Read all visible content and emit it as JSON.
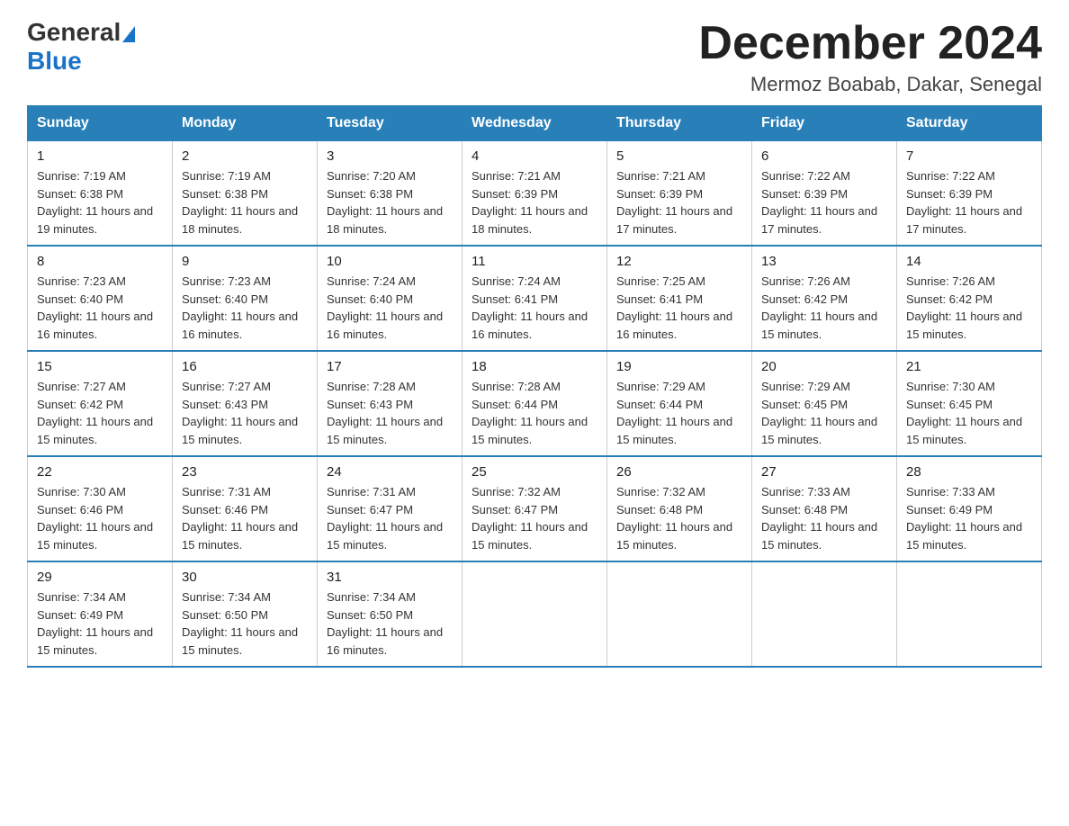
{
  "logo": {
    "general": "General",
    "blue": "Blue"
  },
  "title": "December 2024",
  "subtitle": "Mermoz Boabab, Dakar, Senegal",
  "days_of_week": [
    "Sunday",
    "Monday",
    "Tuesday",
    "Wednesday",
    "Thursday",
    "Friday",
    "Saturday"
  ],
  "weeks": [
    [
      {
        "day": "1",
        "sunrise": "7:19 AM",
        "sunset": "6:38 PM",
        "daylight": "11 hours and 19 minutes."
      },
      {
        "day": "2",
        "sunrise": "7:19 AM",
        "sunset": "6:38 PM",
        "daylight": "11 hours and 18 minutes."
      },
      {
        "day": "3",
        "sunrise": "7:20 AM",
        "sunset": "6:38 PM",
        "daylight": "11 hours and 18 minutes."
      },
      {
        "day": "4",
        "sunrise": "7:21 AM",
        "sunset": "6:39 PM",
        "daylight": "11 hours and 18 minutes."
      },
      {
        "day": "5",
        "sunrise": "7:21 AM",
        "sunset": "6:39 PM",
        "daylight": "11 hours and 17 minutes."
      },
      {
        "day": "6",
        "sunrise": "7:22 AM",
        "sunset": "6:39 PM",
        "daylight": "11 hours and 17 minutes."
      },
      {
        "day": "7",
        "sunrise": "7:22 AM",
        "sunset": "6:39 PM",
        "daylight": "11 hours and 17 minutes."
      }
    ],
    [
      {
        "day": "8",
        "sunrise": "7:23 AM",
        "sunset": "6:40 PM",
        "daylight": "11 hours and 16 minutes."
      },
      {
        "day": "9",
        "sunrise": "7:23 AM",
        "sunset": "6:40 PM",
        "daylight": "11 hours and 16 minutes."
      },
      {
        "day": "10",
        "sunrise": "7:24 AM",
        "sunset": "6:40 PM",
        "daylight": "11 hours and 16 minutes."
      },
      {
        "day": "11",
        "sunrise": "7:24 AM",
        "sunset": "6:41 PM",
        "daylight": "11 hours and 16 minutes."
      },
      {
        "day": "12",
        "sunrise": "7:25 AM",
        "sunset": "6:41 PM",
        "daylight": "11 hours and 16 minutes."
      },
      {
        "day": "13",
        "sunrise": "7:26 AM",
        "sunset": "6:42 PM",
        "daylight": "11 hours and 15 minutes."
      },
      {
        "day": "14",
        "sunrise": "7:26 AM",
        "sunset": "6:42 PM",
        "daylight": "11 hours and 15 minutes."
      }
    ],
    [
      {
        "day": "15",
        "sunrise": "7:27 AM",
        "sunset": "6:42 PM",
        "daylight": "11 hours and 15 minutes."
      },
      {
        "day": "16",
        "sunrise": "7:27 AM",
        "sunset": "6:43 PM",
        "daylight": "11 hours and 15 minutes."
      },
      {
        "day": "17",
        "sunrise": "7:28 AM",
        "sunset": "6:43 PM",
        "daylight": "11 hours and 15 minutes."
      },
      {
        "day": "18",
        "sunrise": "7:28 AM",
        "sunset": "6:44 PM",
        "daylight": "11 hours and 15 minutes."
      },
      {
        "day": "19",
        "sunrise": "7:29 AM",
        "sunset": "6:44 PM",
        "daylight": "11 hours and 15 minutes."
      },
      {
        "day": "20",
        "sunrise": "7:29 AM",
        "sunset": "6:45 PM",
        "daylight": "11 hours and 15 minutes."
      },
      {
        "day": "21",
        "sunrise": "7:30 AM",
        "sunset": "6:45 PM",
        "daylight": "11 hours and 15 minutes."
      }
    ],
    [
      {
        "day": "22",
        "sunrise": "7:30 AM",
        "sunset": "6:46 PM",
        "daylight": "11 hours and 15 minutes."
      },
      {
        "day": "23",
        "sunrise": "7:31 AM",
        "sunset": "6:46 PM",
        "daylight": "11 hours and 15 minutes."
      },
      {
        "day": "24",
        "sunrise": "7:31 AM",
        "sunset": "6:47 PM",
        "daylight": "11 hours and 15 minutes."
      },
      {
        "day": "25",
        "sunrise": "7:32 AM",
        "sunset": "6:47 PM",
        "daylight": "11 hours and 15 minutes."
      },
      {
        "day": "26",
        "sunrise": "7:32 AM",
        "sunset": "6:48 PM",
        "daylight": "11 hours and 15 minutes."
      },
      {
        "day": "27",
        "sunrise": "7:33 AM",
        "sunset": "6:48 PM",
        "daylight": "11 hours and 15 minutes."
      },
      {
        "day": "28",
        "sunrise": "7:33 AM",
        "sunset": "6:49 PM",
        "daylight": "11 hours and 15 minutes."
      }
    ],
    [
      {
        "day": "29",
        "sunrise": "7:34 AM",
        "sunset": "6:49 PM",
        "daylight": "11 hours and 15 minutes."
      },
      {
        "day": "30",
        "sunrise": "7:34 AM",
        "sunset": "6:50 PM",
        "daylight": "11 hours and 15 minutes."
      },
      {
        "day": "31",
        "sunrise": "7:34 AM",
        "sunset": "6:50 PM",
        "daylight": "11 hours and 16 minutes."
      },
      null,
      null,
      null,
      null
    ]
  ]
}
